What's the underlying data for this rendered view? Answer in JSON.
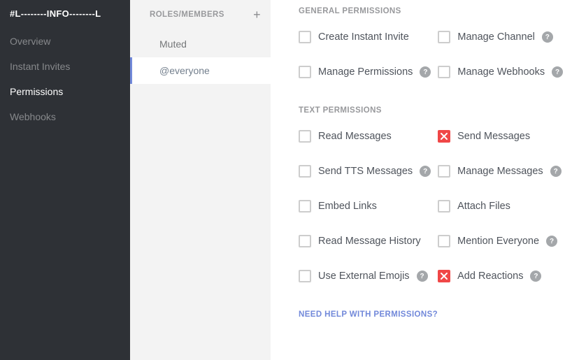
{
  "sidebar": {
    "title": "#L--------INFO--------L",
    "items": [
      {
        "label": "Overview"
      },
      {
        "label": "Instant Invites"
      },
      {
        "label": "Permissions"
      },
      {
        "label": "Webhooks"
      }
    ],
    "active_index": 2
  },
  "roles": {
    "heading": "ROLES/MEMBERS",
    "add_glyph": "+",
    "items": [
      {
        "label": "Muted"
      },
      {
        "label": "@everyone"
      }
    ],
    "selected_index": 1
  },
  "sections": {
    "general": {
      "heading": "GENERAL PERMISSIONS",
      "perms": [
        {
          "label": "Create Instant Invite",
          "state": "neutral",
          "help": false
        },
        {
          "label": "Manage Channel",
          "state": "neutral",
          "help": true
        },
        {
          "label": "Manage Permissions",
          "state": "neutral",
          "help": true
        },
        {
          "label": "Manage Webhooks",
          "state": "neutral",
          "help": true
        }
      ]
    },
    "text": {
      "heading": "TEXT PERMISSIONS",
      "perms": [
        {
          "label": "Read Messages",
          "state": "neutral",
          "help": false
        },
        {
          "label": "Send Messages",
          "state": "denied",
          "help": false
        },
        {
          "label": "Send TTS Messages",
          "state": "neutral",
          "help": true
        },
        {
          "label": "Manage Messages",
          "state": "neutral",
          "help": true
        },
        {
          "label": "Embed Links",
          "state": "neutral",
          "help": false
        },
        {
          "label": "Attach Files",
          "state": "neutral",
          "help": false
        },
        {
          "label": "Read Message History",
          "state": "neutral",
          "help": false
        },
        {
          "label": "Mention Everyone",
          "state": "neutral",
          "help": true
        },
        {
          "label": "Use External Emojis",
          "state": "neutral",
          "help": true
        },
        {
          "label": "Add Reactions",
          "state": "denied",
          "help": true
        }
      ]
    }
  },
  "help_link": "NEED HELP WITH PERMISSIONS?",
  "help_glyph": "?"
}
